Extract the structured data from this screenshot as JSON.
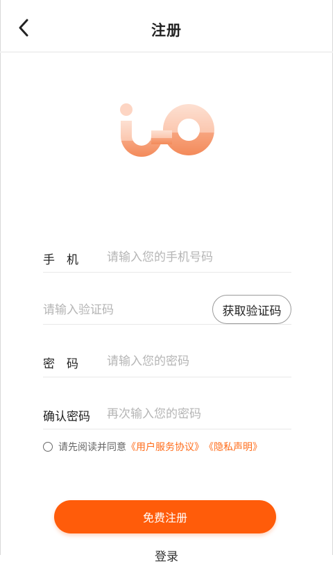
{
  "header": {
    "title": "注册",
    "back_icon": "chevron-left-icon"
  },
  "logo": {
    "name": "brand-logo",
    "colors": {
      "light": "#fcd3c2",
      "dark": "#f5946a"
    }
  },
  "form": {
    "phone": {
      "label": "手　机",
      "placeholder": "请输入您的手机号码",
      "value": ""
    },
    "code": {
      "placeholder": "请输入验证码",
      "value": "",
      "button_label": "获取验证码"
    },
    "password": {
      "label": "密　码",
      "placeholder": "请输入您的密码",
      "value": ""
    },
    "confirm": {
      "label": "确认密码",
      "placeholder": "再次输入您的密码",
      "value": ""
    }
  },
  "agreement": {
    "text": "请先阅读并同意",
    "link_terms": "《用户服务协议》",
    "link_privacy": "《隐私声明》",
    "checked": false
  },
  "actions": {
    "submit_label": "免费注册",
    "login_label": "登录"
  },
  "colors": {
    "accent": "#ff5c0a",
    "link": "#ff6c1a"
  }
}
